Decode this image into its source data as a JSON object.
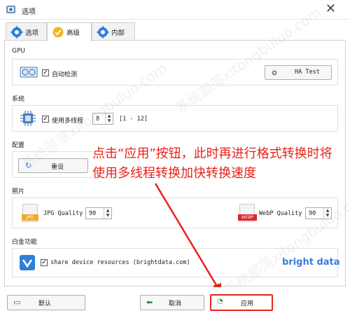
{
  "window": {
    "title": "选项",
    "close_symbol": "✕"
  },
  "tabs": [
    {
      "label": "选项",
      "icon": "gear-icon",
      "active": false
    },
    {
      "label": "高级",
      "icon": "advanced-icon",
      "active": true
    },
    {
      "label": "内部",
      "icon": "gear-icon",
      "active": false
    }
  ],
  "gpu": {
    "section_label": "GPU",
    "checkbox_label": "自动检测",
    "checked": true,
    "test_button": "HA Test"
  },
  "system": {
    "section_label": "系统",
    "checkbox_label": "使用多线程",
    "checked": true,
    "thread_value": "8",
    "range_text": "[1 - 12]"
  },
  "config": {
    "section_label": "配置",
    "reset_button": "重设"
  },
  "photo": {
    "section_label": "照片",
    "jpg_label": "JPG Quality",
    "jpg_value": "90",
    "jpg_badge": "JPG",
    "webp_label": "WebP Quality",
    "webp_value": "90",
    "webp_badge": "WEBP"
  },
  "platinum": {
    "section_label": "白金功能",
    "checkbox_label": "share device resources (brightdata.com)",
    "checked": true,
    "brand": "bright data",
    "brand_color": "#3d7bd9"
  },
  "annotation": {
    "text": "点击“应用”按钮，此时再进行格式转换时将使用多线程转换加快转换速度",
    "color": "#e8221b"
  },
  "footer": {
    "default_button": "默认",
    "cancel_button": "取消",
    "apply_button": "应用"
  },
  "watermark_text": "系统部落xitongbuluo.com"
}
